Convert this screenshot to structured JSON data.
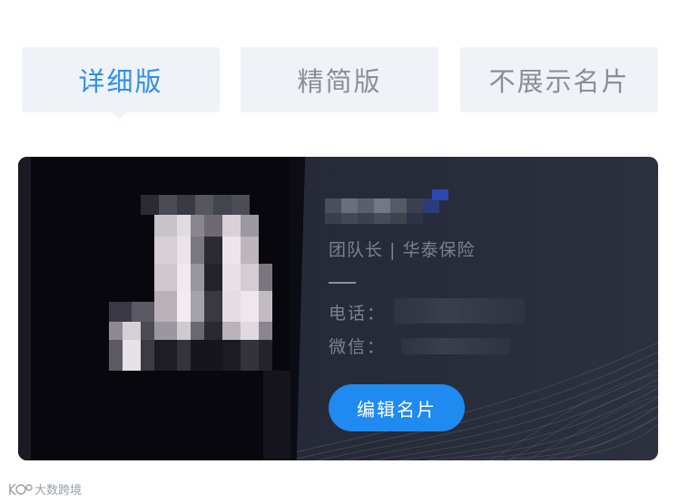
{
  "tabs": [
    {
      "label": "详细版",
      "active": true
    },
    {
      "label": "精简版",
      "active": false
    },
    {
      "label": "不展示名片",
      "active": false
    }
  ],
  "card": {
    "title_line": "团队长 | 华泰保险",
    "phone_label": "电话：",
    "wechat_label": "微信：",
    "edit_button_label": "编辑名片"
  },
  "colors": {
    "accent": "#2f8ff0",
    "button": "#1f8aef",
    "card_background": "#262b38"
  },
  "watermark": {
    "text": "大数跨境"
  }
}
